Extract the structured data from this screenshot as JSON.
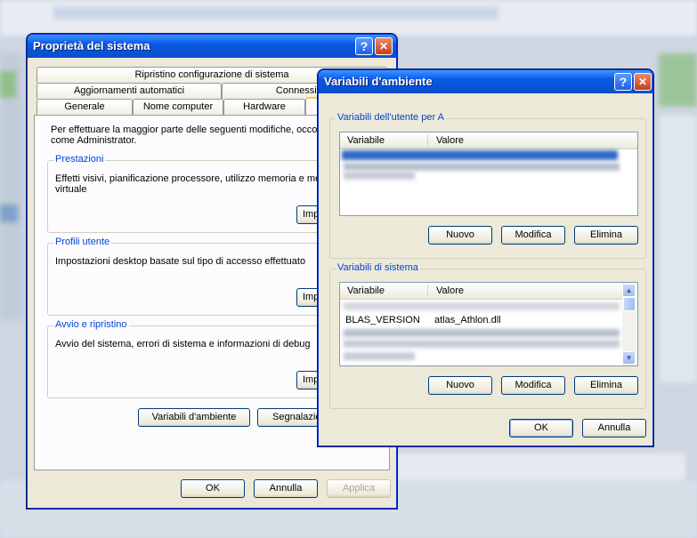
{
  "sys_props": {
    "title": "Proprietà del sistema",
    "help": "?",
    "close": "✕",
    "tabs_row1": [
      "Ripristino configurazione di sistema"
    ],
    "tabs_row2": [
      "Aggiornamenti automatici",
      "Connessione"
    ],
    "tabs_row3": [
      "Generale",
      "Nome computer",
      "Hardware"
    ],
    "intro": "Per effettuare la maggior parte delle seguenti modifiche, occorre",
    "intro2": "come Administrator.",
    "groups": [
      {
        "legend": "Prestazioni",
        "line1": "Effetti visivi, pianificazione processore, utilizzo memoria e memo",
        "line2": "virtuale",
        "button": "Imp"
      },
      {
        "legend": "Profili utente",
        "line1": "Impostazioni desktop basate sul tipo di accesso effettuato",
        "line2": "",
        "button": "Imp"
      },
      {
        "legend": "Avvio e ripristino",
        "line1": "Avvio del sistema, errori di sistema e informazioni di debug",
        "line2": "",
        "button": "Imp"
      }
    ],
    "env_button": "Variabili d'ambiente",
    "report_button": "Segnalazio",
    "ok": "OK",
    "cancel": "Annulla",
    "apply": "Applica"
  },
  "env_vars": {
    "title": "Variabili d'ambiente",
    "help": "?",
    "close": "✕",
    "user_group": "Variabili dell'utente per A",
    "sys_group": "Variabili di sistema",
    "col_variable": "Variabile",
    "col_value": "Valore",
    "sys_row": {
      "variable": "BLAS_VERSION",
      "value": "atlas_Athlon.dll"
    },
    "new": "Nuovo",
    "edit": "Modifica",
    "delete": "Elimina",
    "ok": "OK",
    "cancel": "Annulla"
  },
  "colors": {
    "title_blue": "#0a58e8",
    "selection": "#316ac5",
    "legend": "#0046d5"
  }
}
